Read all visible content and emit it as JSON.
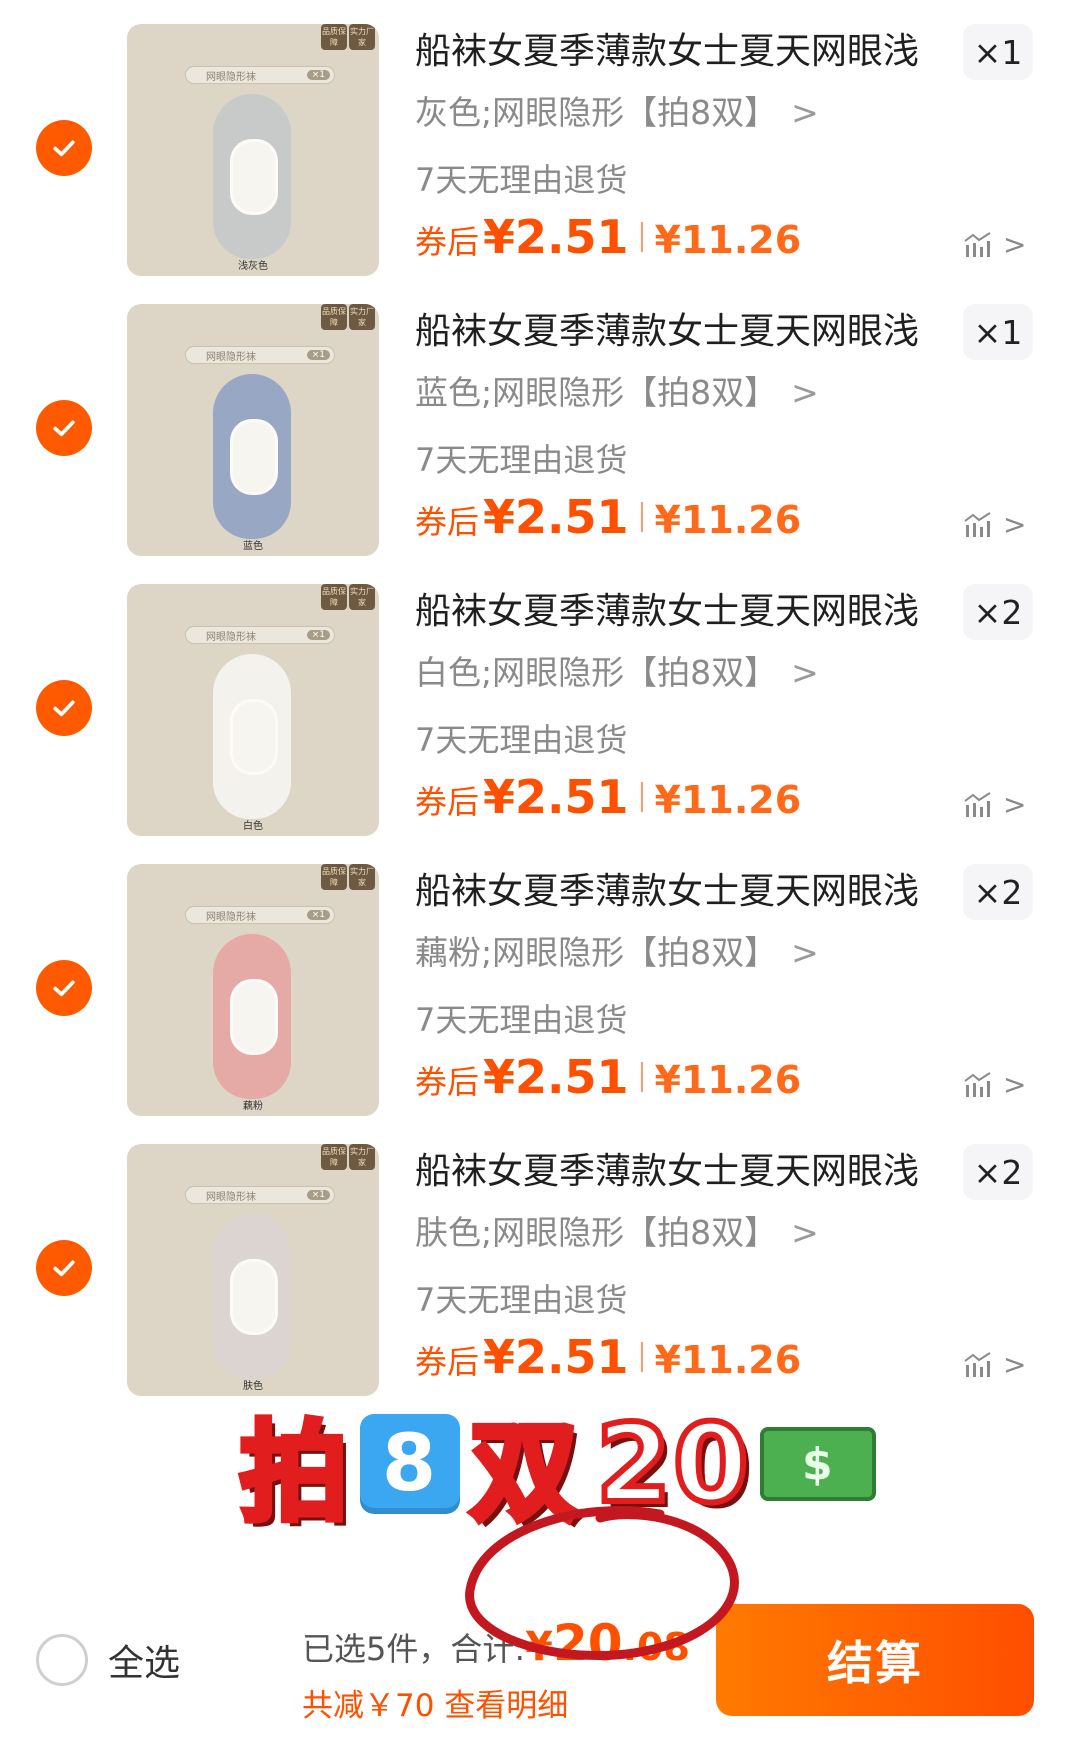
{
  "colors": {
    "accent": "#ff5000",
    "check": "#ff5a00",
    "circle_mark": "#c41820"
  },
  "items": [
    {
      "title": "船袜女夏季薄款女士夏天网眼浅",
      "sku": "灰色;网眼隐形【拍8双】",
      "return_policy": "7天无理由退货",
      "price_prefix": "券后",
      "price_after": "¥2.51",
      "price_orig": "¥11.26",
      "qty": "×1",
      "thumb_tag": "网眼隐形袜",
      "thumb_tag_qty": "×1",
      "thumb_badge_1": "品质保障",
      "thumb_badge_2": "实力厂家",
      "thumb_color_label": "浅灰色",
      "sock_color": "#c8cac9"
    },
    {
      "title": "船袜女夏季薄款女士夏天网眼浅",
      "sku": "蓝色;网眼隐形【拍8双】",
      "return_policy": "7天无理由退货",
      "price_prefix": "券后",
      "price_after": "¥2.51",
      "price_orig": "¥11.26",
      "qty": "×1",
      "thumb_tag": "网眼隐形袜",
      "thumb_tag_qty": "×1",
      "thumb_badge_1": "品质保障",
      "thumb_badge_2": "实力厂家",
      "thumb_color_label": "蓝色",
      "sock_color": "#98a7c4"
    },
    {
      "title": "船袜女夏季薄款女士夏天网眼浅",
      "sku": "白色;网眼隐形【拍8双】",
      "return_policy": "7天无理由退货",
      "price_prefix": "券后",
      "price_after": "¥2.51",
      "price_orig": "¥11.26",
      "qty": "×2",
      "thumb_tag": "网眼隐形袜",
      "thumb_tag_qty": "×1",
      "thumb_badge_1": "品质保障",
      "thumb_badge_2": "实力厂家",
      "thumb_color_label": "白色",
      "sock_color": "#f3f2ec"
    },
    {
      "title": "船袜女夏季薄款女士夏天网眼浅",
      "sku": "藕粉;网眼隐形【拍8双】",
      "return_policy": "7天无理由退货",
      "price_prefix": "券后",
      "price_after": "¥2.51",
      "price_orig": "¥11.26",
      "qty": "×2",
      "thumb_tag": "网眼隐形袜",
      "thumb_tag_qty": "×1",
      "thumb_badge_1": "品质保障",
      "thumb_badge_2": "实力厂家",
      "thumb_color_label": "藕粉",
      "sock_color": "#e5a9a6"
    },
    {
      "title": "船袜女夏季薄款女士夏天网眼浅",
      "sku": "肤色;网眼隐形【拍8双】",
      "return_policy": "7天无理由退货",
      "price_prefix": "券后",
      "price_after": "¥2.51",
      "price_orig": "¥11.26",
      "qty": "×2",
      "thumb_tag": "网眼隐形袜",
      "thumb_tag_qty": "×1",
      "thumb_badge_1": "品质保障",
      "thumb_badge_2": "实力厂家",
      "thumb_color_label": "肤色",
      "sock_color": "#dcd4d0"
    }
  ],
  "overlay": {
    "char1": "拍",
    "digit": "8",
    "char2": "双",
    "amount": "20",
    "money_glyph": "$"
  },
  "footer": {
    "select_all": "全选",
    "selected_text": "已选5件，合计:",
    "total_currency": "¥",
    "total_int": "20",
    "total_dec": ".08",
    "discount_text": "共减￥70 查看明细",
    "checkout_label": "结算"
  }
}
